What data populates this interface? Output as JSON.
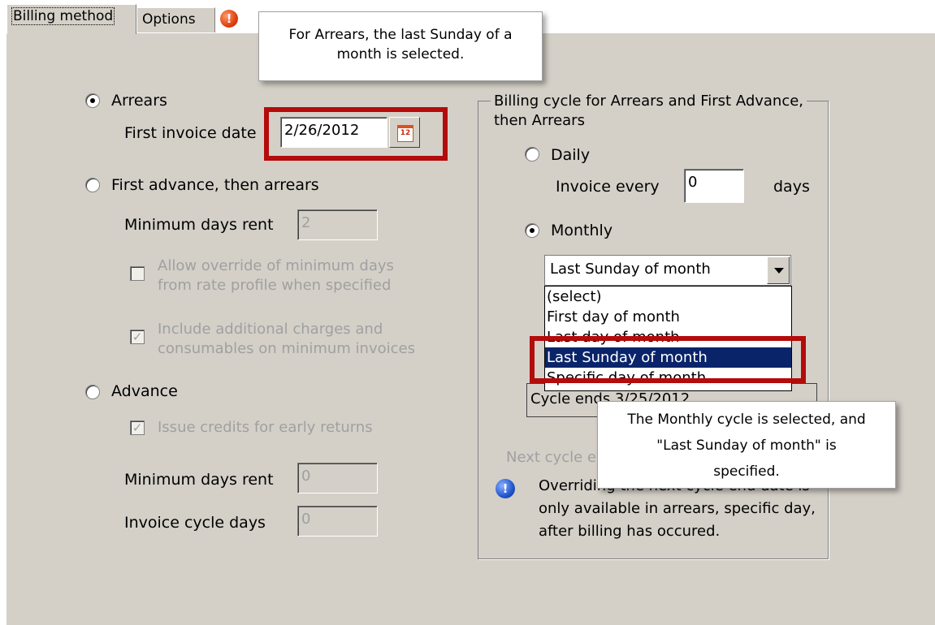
{
  "tabs": {
    "billing_method": "Billing method",
    "options": "Options",
    "error_icon": "!"
  },
  "callouts": {
    "top": "For Arrears, the last Sunday of a\nmonth is selected.",
    "bottom": "The Monthly cycle is selected, and\n\"Last Sunday of month\" is\nspecified."
  },
  "left": {
    "arrears_label": "Arrears",
    "first_invoice_label": "First invoice date",
    "first_invoice_value": "2/26/2012",
    "first_advance_label": "First advance, then arrears",
    "min_days_rent_label": "Minimum days rent",
    "min_days_rent_value": "2",
    "allow_override_line1": "Allow override of minimum days",
    "allow_override_line2": "from rate profile when specified",
    "include_charges_line1": "Include additional charges and",
    "include_charges_line2": "consumables on minimum invoices",
    "advance_label": "Advance",
    "issue_credits_label": "Issue credits for early returns",
    "adv_min_days_label": "Minimum days rent",
    "adv_min_days_value": "0",
    "invoice_cycle_label": "Invoice cycle days",
    "invoice_cycle_value": "0",
    "check_mark": "✓"
  },
  "group": {
    "legend": "Billing cycle for Arrears and First Advance,\nthen Arrears",
    "daily_label": "Daily",
    "invoice_every_label": "Invoice every",
    "invoice_every_value": "0",
    "days_label": "days",
    "monthly_label": "Monthly",
    "dropdown_value": "Last Sunday of month",
    "dropdown_options": [
      "(select)",
      "First day of month",
      "Last day of month",
      "Last Sunday of month",
      "Specific day of month"
    ],
    "cycle_ends_text": "Cycle ends 3/25/2012",
    "next_cycle_label": "Next cycle e",
    "info_icon": "!",
    "info_text": "Overriding the next cycle end date is\nonly available in arrears, specific day,\nafter billing has occured."
  }
}
